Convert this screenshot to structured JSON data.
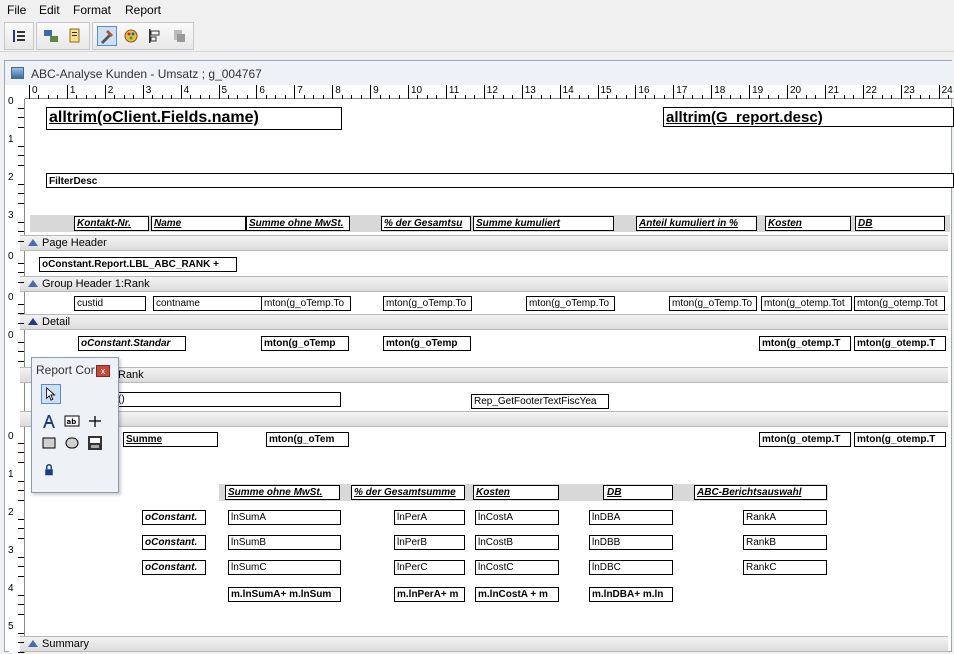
{
  "menu": [
    "File",
    "Edit",
    "Format",
    "Report"
  ],
  "window": {
    "title": "ABC-Analyse Kunden - Umsatz ; g_004767"
  },
  "ruler": {
    "h": [
      "0",
      "1",
      "2",
      "3",
      "4",
      "5",
      "6",
      "7",
      "8",
      "9",
      "10",
      "11",
      "12",
      "13",
      "14",
      "15",
      "16",
      "17",
      "18",
      "19",
      "20",
      "21",
      "22",
      "23",
      "24"
    ]
  },
  "bands": {
    "page_header": "Page Header",
    "group_header": "Group Header 1:Rank",
    "detail": "Detail",
    "group_footer_partial": "Rank",
    "summary": "Summary"
  },
  "title_section": {
    "client_name": "alltrim(oClient.Fields.name)",
    "report_desc": "alltrim(G_report.desc)",
    "filter": "FilterDesc"
  },
  "column_headers": [
    "Kontakt-Nr.",
    "Name",
    "Summe ohne MwSt.",
    "% der Gesamtsu",
    "Summe kumuliert",
    "Anteil kumuliert in %",
    "Kosten",
    "DB"
  ],
  "group_header_field": "oConstant.Report.LBL_ABC_RANK +",
  "detail_fields": [
    "custid",
    "contname",
    "mton(g_oTemp.To",
    "mton(g_oTemp.To",
    "mton(g_oTemp.To",
    "mton(g_oTemp.To",
    "mton(g_otemp.Tot",
    "mton(g_otemp.Tot"
  ],
  "group_footer_fields": [
    "oConstant.Standar",
    "mton(g_oTemp",
    "mton(g_oTemp",
    "mton(g_otemp.T",
    "mton(g_otemp.T"
  ],
  "page_footer": {
    "left": "()",
    "right": "Rep_GetFooterTextFiscYea"
  },
  "summary_row": {
    "label": "Summe",
    "f1": "mton(g_oTem",
    "f2": "mton(g_otemp.T",
    "f3": "mton(g_otemp.T"
  },
  "abc_table": {
    "headers": [
      "Summe ohne MwSt.",
      "% der Gesamtsumme",
      "Kosten",
      "DB",
      "ABC-Berichtsauswahl"
    ],
    "row_label": "oConstant.",
    "rows": [
      [
        "lnSumA",
        "lnPerA",
        "lnCostA",
        "lnDBA",
        "RankA"
      ],
      [
        "lnSumB",
        "lnPerB",
        "lnCostB",
        "lnDBB",
        "RankB"
      ],
      [
        "lnSumC",
        "lnPerC",
        "lnCostC",
        "lnDBC",
        "RankC"
      ]
    ],
    "totals": [
      "m.lnSumA+ m.lnSum",
      "m.lnPerA+ m",
      "m.lnCostA + m",
      "m.lnDBA+ m.ln"
    ]
  },
  "palette": {
    "title": "Report Cor",
    "close": "x"
  }
}
